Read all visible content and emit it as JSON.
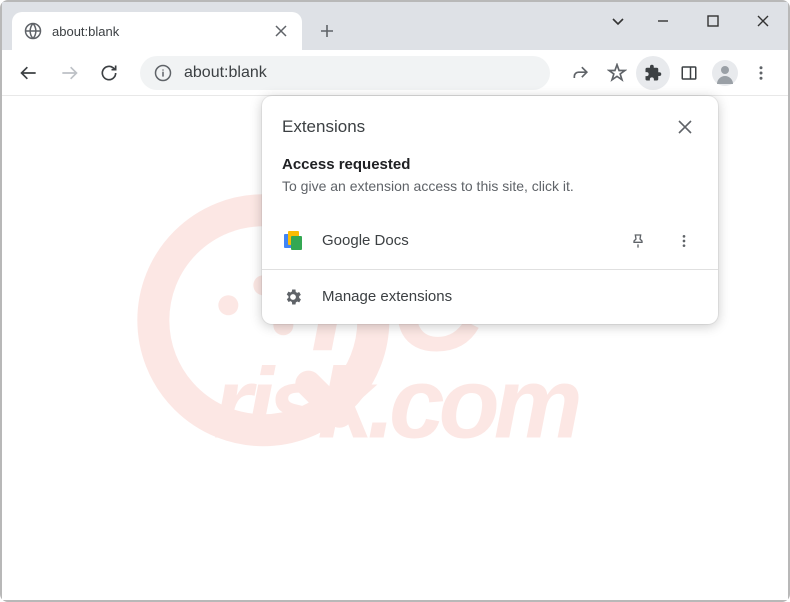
{
  "tab": {
    "title": "about:blank"
  },
  "omnibox": {
    "url": "about:blank"
  },
  "extensions_popup": {
    "title": "Extensions",
    "section_title": "Access requested",
    "section_desc": "To give an extension access to this site, click it.",
    "items": [
      {
        "name": "Google Docs"
      }
    ],
    "manage_label": "Manage extensions"
  },
  "watermark": {
    "line1": "PC",
    "line2": "risk.com"
  }
}
